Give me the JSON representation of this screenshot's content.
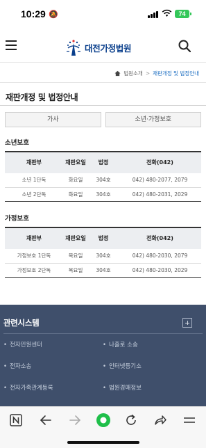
{
  "status": {
    "time": "10:29",
    "battery": "74"
  },
  "header": {
    "logo_text": "대전가정법원"
  },
  "breadcrumb": {
    "items": [
      "법원소개",
      "재판개정 및 법정안내"
    ]
  },
  "page": {
    "title": "재판개정 및 법정안내"
  },
  "tabs": [
    "가사",
    "소년·가정보호"
  ],
  "juvenile": {
    "label": "소년보호",
    "headers": [
      "재판부",
      "재판요일",
      "법정",
      "전화(042)"
    ],
    "rows": [
      [
        "소년 1단독",
        "화요일",
        "304호",
        "042) 480-2077, 2079"
      ],
      [
        "소년 2단독",
        "화요일",
        "304호",
        "042) 480-2031, 2029"
      ]
    ]
  },
  "family": {
    "label": "가정보호",
    "headers": [
      "재판부",
      "재판요일",
      "법정",
      "전화(042)"
    ],
    "rows": [
      [
        "가정보호 1단독",
        "목요일",
        "304호",
        "042) 480-2030, 2079"
      ],
      [
        "가정보호 2단독",
        "목요일",
        "304호",
        "042) 480-2030, 2029"
      ]
    ]
  },
  "related": {
    "title": "관련시스템",
    "items": [
      "전자민원센터",
      "나홀로 소송",
      "전자소송",
      "인터넷등기소",
      "전자가족관계등록",
      "법원경매정보"
    ]
  },
  "colors": {
    "brand": "#0a3f8c",
    "related_bg": "#3f4f6b",
    "active_dot": "#1fbf4a",
    "link": "#1e6fc2"
  },
  "bottom_nav": [
    "naver-n-icon",
    "back-arrow-icon",
    "forward-arrow-icon",
    "home-dot-icon",
    "reload-icon",
    "share-icon",
    "menu-icon"
  ]
}
